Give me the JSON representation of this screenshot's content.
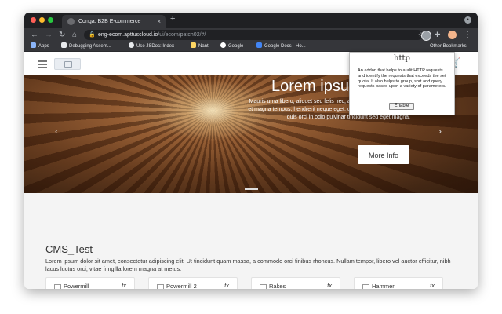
{
  "browser": {
    "tab_title": "Conga: B2B E-commerce",
    "tab_close": "×",
    "new_tab": "+",
    "back": "←",
    "forward": "→",
    "reload": "↻",
    "home": "⌂",
    "url_host": "eng-ecom.apttuscloud.io",
    "url_path": "/ui/ecom/patch02/#/",
    "star": "☆",
    "menu": "⋮"
  },
  "bookmarks": {
    "items": [
      {
        "label": "Apps",
        "color": "#8ab4f8"
      },
      {
        "label": "Debugging Assem...",
        "color": "#e8eaed"
      },
      {
        "label": "Use JSDoc: Index",
        "color": "#e8eaed"
      },
      {
        "label": "Nant",
        "color": "#fdd663"
      },
      {
        "label": "Google",
        "color": "#ffffff"
      },
      {
        "label": "Google Docs - Ho...",
        "color": "#4285f4"
      }
    ],
    "other": "Other Bookmarks"
  },
  "site": {
    "search_icon": "search-icon",
    "cart_icon": "cart-icon",
    "accent_color": "#0a6ed1"
  },
  "hero": {
    "title": "Lorem ipsum",
    "text": "Mauris urna libero, aliquet sed felis nec, aliquam gravida ex. Morbi et magna tempus, hendrerit neque eget, convallis ex. Suspendisse quis orci in odio pulvinar tincidunt sed eget magna.",
    "button": "More Info",
    "prev": "‹",
    "next": "›"
  },
  "cms": {
    "title": "CMS_Test",
    "text": "Lorem ipsum dolor sit amet, consectetur adipiscing elit. Ut tincidunt quam massa, a commodo orci finibus rhoncus. Nullam tempor, libero vel auctor efficitur, nibh lacus luctus orci, vitae fringilla lorem magna at metus.",
    "cards": [
      {
        "label": "Powermill",
        "fx": "fx"
      },
      {
        "label": "Powermill 2",
        "fx": "fx"
      },
      {
        "label": "Rakes",
        "fx": "fx"
      },
      {
        "label": "Hammer",
        "fx": "fx"
      }
    ]
  },
  "popup": {
    "title": "http",
    "text": "An addon that helps to audit HTTP requests and identify the requests that exceeds the set quota. It also helps to group, sort and query requests based upon a variety of parameters.",
    "button": "Enable"
  }
}
